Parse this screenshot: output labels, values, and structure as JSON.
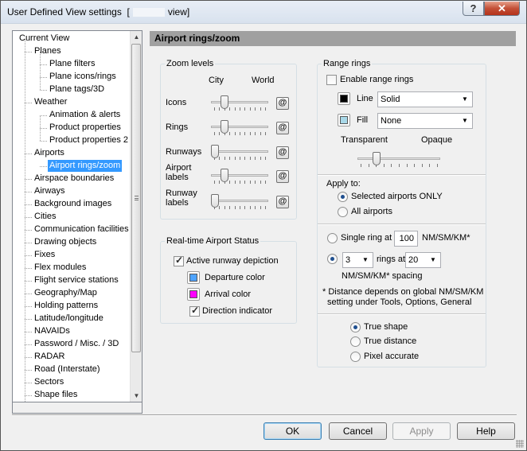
{
  "window": {
    "title_prefix": "User Defined View settings  [",
    "title_suffix": "view]",
    "help_button": "?",
    "close_button": "✕"
  },
  "tree": {
    "items": [
      {
        "label": "Current View"
      },
      {
        "label": "Planes"
      },
      {
        "label": "Plane filters"
      },
      {
        "label": "Plane icons/rings"
      },
      {
        "label": "Plane tags/3D"
      },
      {
        "label": "Weather"
      },
      {
        "label": "Animation & alerts"
      },
      {
        "label": "Product properties"
      },
      {
        "label": "Product properties 2"
      },
      {
        "label": "Airports"
      },
      {
        "label": "Airport rings/zoom"
      },
      {
        "label": "Airspace boundaries"
      },
      {
        "label": "Airways"
      },
      {
        "label": "Background images"
      },
      {
        "label": "Cities"
      },
      {
        "label": "Communication facilities"
      },
      {
        "label": "Drawing objects"
      },
      {
        "label": "Fixes"
      },
      {
        "label": "Flex modules"
      },
      {
        "label": "Flight service stations"
      },
      {
        "label": "Geography/Map"
      },
      {
        "label": "Holding patterns"
      },
      {
        "label": "Latitude/longitude"
      },
      {
        "label": "NAVAIDs"
      },
      {
        "label": "Password / Misc. / 3D"
      },
      {
        "label": "RADAR"
      },
      {
        "label": "Road (Interstate)"
      },
      {
        "label": "Sectors"
      },
      {
        "label": "Shape files"
      }
    ],
    "selected": "Airport rings/zoom"
  },
  "header": {
    "title": "Airport rings/zoom"
  },
  "zoom": {
    "title": "Zoom levels",
    "col_city": "City",
    "col_world": "World",
    "at_symbol": "@",
    "rows": [
      {
        "label": "Icons",
        "level": 0.2
      },
      {
        "label": "Rings",
        "level": 0.2
      },
      {
        "label": "Runways",
        "level": 0.0
      },
      {
        "label": "Airport labels",
        "level": 0.2
      },
      {
        "label": "Runway labels",
        "level": 0.0
      }
    ],
    "row_label_lines": [
      [
        "Icons"
      ],
      [
        "Rings"
      ],
      [
        "Runways"
      ],
      [
        "Airport",
        "labels"
      ],
      [
        "Runway",
        "labels"
      ]
    ]
  },
  "status": {
    "title": "Real-time Airport Status",
    "active_runway": "Active runway depiction",
    "active_runway_checked": true,
    "departure_color_label": "Departure color",
    "departure_color": "#4da3ff",
    "arrival_color_label": "Arrival color",
    "arrival_color": "#ff00ff",
    "direction_indicator": "Direction indicator",
    "direction_indicator_checked": true
  },
  "range": {
    "title": "Range rings",
    "enable_label": "Enable range rings",
    "enable_checked": false,
    "line_label": "Line",
    "line_color": "#000000",
    "line_value": "Solid",
    "fill_label": "Fill",
    "fill_color": "#a8d8e8",
    "fill_value": "None",
    "transparent_label": "Transparent",
    "opaque_label": "Opaque",
    "opacity_level": 0.2,
    "apply_to_label": "Apply to:",
    "selected_airports_label": "Selected airports ONLY",
    "all_airports_label": "All airports",
    "apply_selection": "Selected airports ONLY",
    "single_ring_label": "Single ring at",
    "single_ring_value": "100",
    "single_ring_units": "NM/SM/KM*",
    "multi_count": "3",
    "rings_at_label": "rings at",
    "rings_at_value": "20",
    "spacing_label": "NM/SM/KM* spacing",
    "ring_mode": "multiple",
    "note_line1": "* Distance depends on global NM/SM/KM",
    "note_line2": "setting under Tools, Options, General",
    "true_shape_label": "True shape",
    "true_distance_label": "True distance",
    "pixel_accurate_label": "Pixel accurate",
    "shape_mode": "True shape"
  },
  "footer": {
    "ok": "OK",
    "cancel": "Cancel",
    "apply": "Apply",
    "help": "Help"
  }
}
